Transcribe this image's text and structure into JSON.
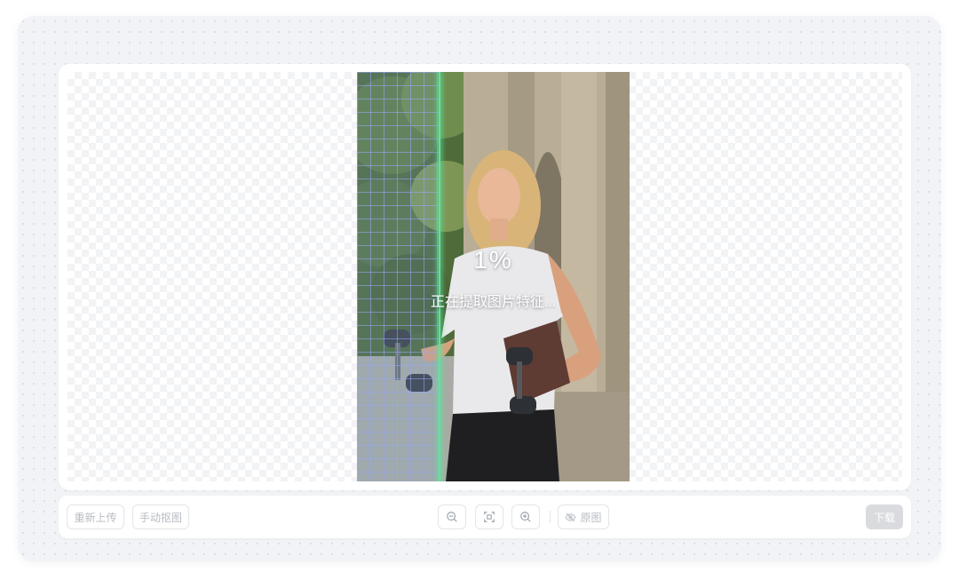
{
  "processing": {
    "progress_label": "1%",
    "status_label": "正在提取图片特征..."
  },
  "toolbar": {
    "reupload_label": "重新上传",
    "manual_cutout_label": "手动抠图",
    "compare_original_label": "原图",
    "download_label": "下载",
    "zoom_out_icon": "zoom-out-icon",
    "fit_screen_icon": "fit-screen-icon",
    "zoom_in_icon": "zoom-in-icon",
    "eye_off_icon": "eye-off-icon"
  },
  "colors": {
    "scan_line": "#5fe39a",
    "grid": "#96aaff",
    "disabled_text": "#b8bcc3",
    "download_bg": "#d9dbde"
  }
}
